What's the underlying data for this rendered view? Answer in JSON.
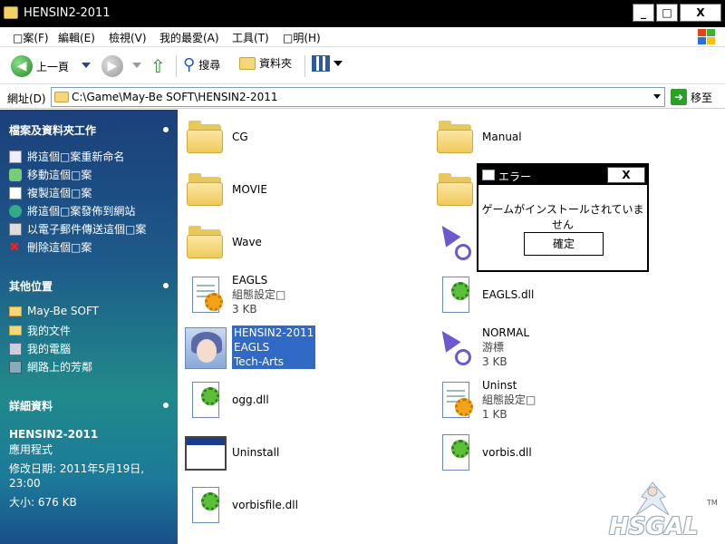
{
  "window": {
    "title": "HENSIN2-2011",
    "minimize": "_",
    "maximize": "□",
    "close": "X"
  },
  "menubar": {
    "items": [
      "□案(F)",
      "編輯(E)",
      "檢視(V)",
      "我的最愛(A)",
      "工具(T)",
      "□明(H)"
    ]
  },
  "toolbar": {
    "back_label": "上一頁",
    "search_label": "搜尋",
    "folders_label": "資料夾"
  },
  "address": {
    "label": "網址(D)",
    "path": "C:\\Game\\May-Be SOFT\\HENSIN2-2011",
    "go_label": "移至"
  },
  "taskpane": {
    "tasks": {
      "title": "檔案及資料夾工作",
      "items": [
        "將這個□案重新命名",
        "移動這個□案",
        "複製這個□案",
        "將這個□案發佈到網站",
        "以電子郵件傳送這個□案",
        "刪除這個□案"
      ]
    },
    "places": {
      "title": "其他位置",
      "items": [
        "May-Be SOFT",
        "我的文件",
        "我的電腦",
        "網路上的芳鄰"
      ]
    },
    "details": {
      "title": "詳細資料",
      "name": "HENSIN2-2011",
      "type": "應用程式",
      "modified": "修改日期: 2011年5月19日, 23:00",
      "size": "大小: 676 KB"
    }
  },
  "files": [
    {
      "name": "CG"
    },
    {
      "name": "Manual"
    },
    {
      "name": "MOVIE"
    },
    {
      "name": "Wave"
    },
    {
      "name": "EAGLS",
      "line2": "組態設定□",
      "line3": "3 KB"
    },
    {
      "name": "EAGLS.dll"
    },
    {
      "name": "HENSIN2-2011",
      "line2": "EAGLS",
      "line3": "Tech-Arts"
    },
    {
      "name": "NORMAL",
      "line2": "游標",
      "line3": "3 KB"
    },
    {
      "name": "ogg.dll"
    },
    {
      "name": "Uninst",
      "line2": "組態設定□",
      "line3": "1 KB"
    },
    {
      "name": "Uninstall"
    },
    {
      "name": "vorbis.dll"
    },
    {
      "name": "vorbisfile.dll"
    }
  ],
  "dialog": {
    "title": "エラー",
    "close": "X",
    "message": "ゲームがインストールされていません",
    "ok": "確定"
  },
  "watermark": {
    "logo_text": "HSGAL",
    "tm": "TM"
  }
}
